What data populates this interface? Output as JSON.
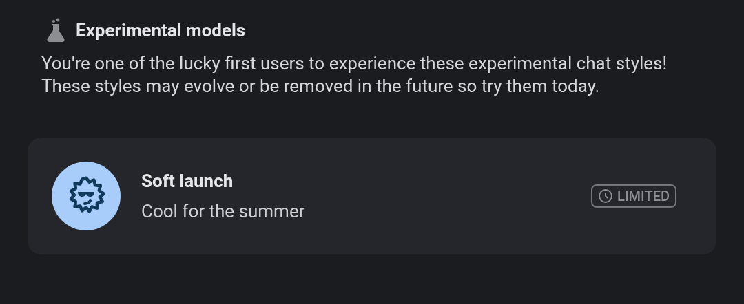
{
  "section": {
    "title": "Experimental models",
    "description": "You're one of the lucky first users to experience these experimental chat styles! These styles may evolve or be removed in the future so try them today."
  },
  "models": [
    {
      "name": "Soft launch",
      "tagline": "Cool for the summer",
      "badge": "LIMITED"
    }
  ]
}
